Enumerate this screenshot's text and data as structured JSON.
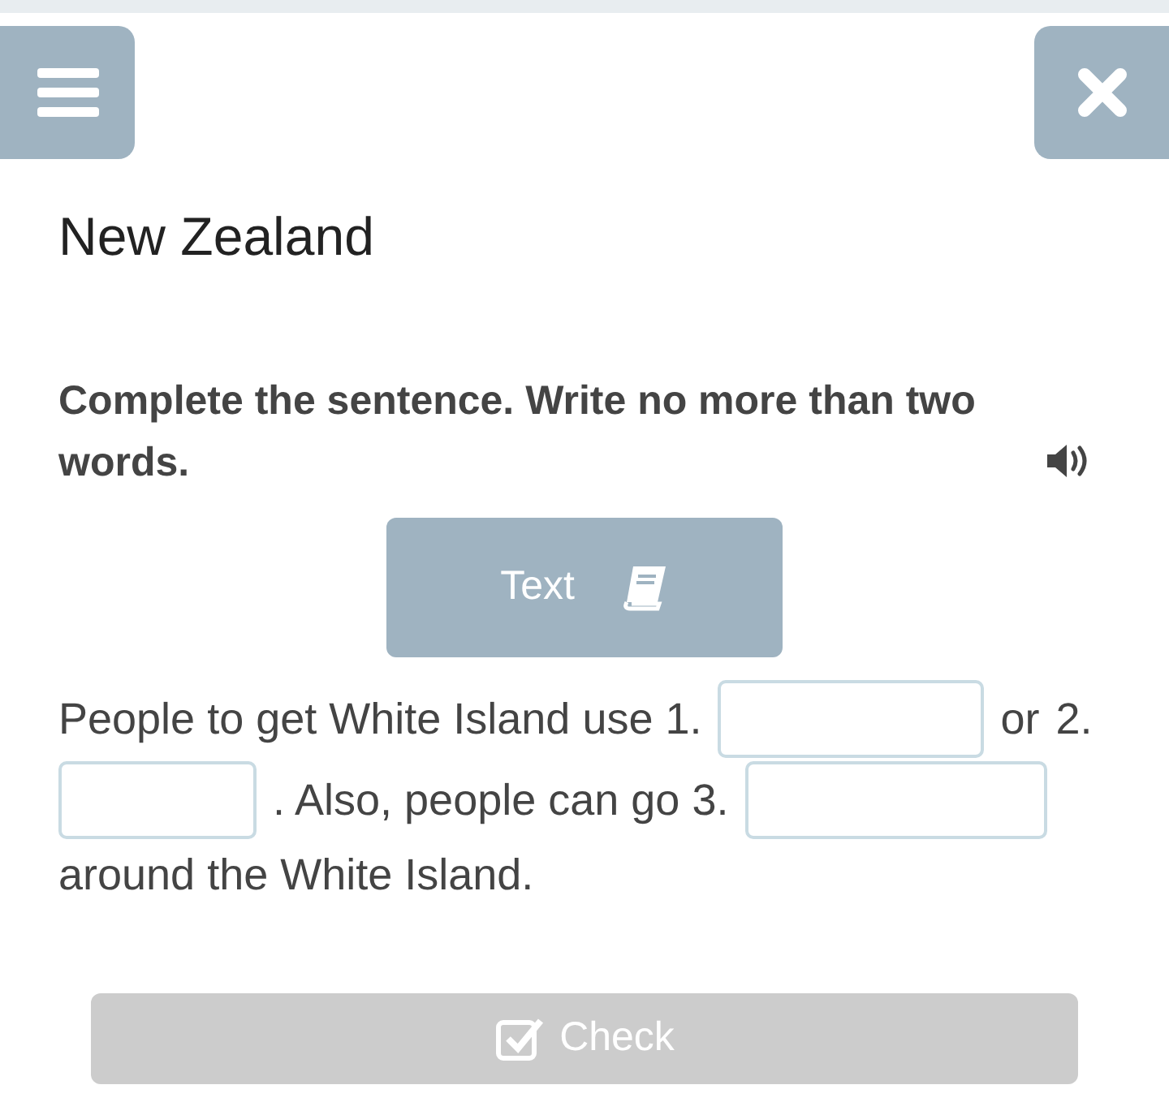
{
  "title": "New Zealand",
  "instruction": "Complete the sentence. Write no more than two words.",
  "text_button": {
    "label": "Text"
  },
  "sentence": [
    {
      "kind": "text",
      "text": "People to get White Island use 1."
    },
    {
      "kind": "blank"
    },
    {
      "kind": "text",
      "text": "or"
    },
    {
      "kind": "text",
      "text": "2."
    },
    {
      "kind": "blank"
    },
    {
      "kind": "text",
      "text": ". Also, people can go 3."
    },
    {
      "kind": "blank"
    },
    {
      "kind": "text",
      "text": "around the White Island."
    }
  ],
  "check_button": {
    "label": "Check",
    "disabled": true
  }
}
